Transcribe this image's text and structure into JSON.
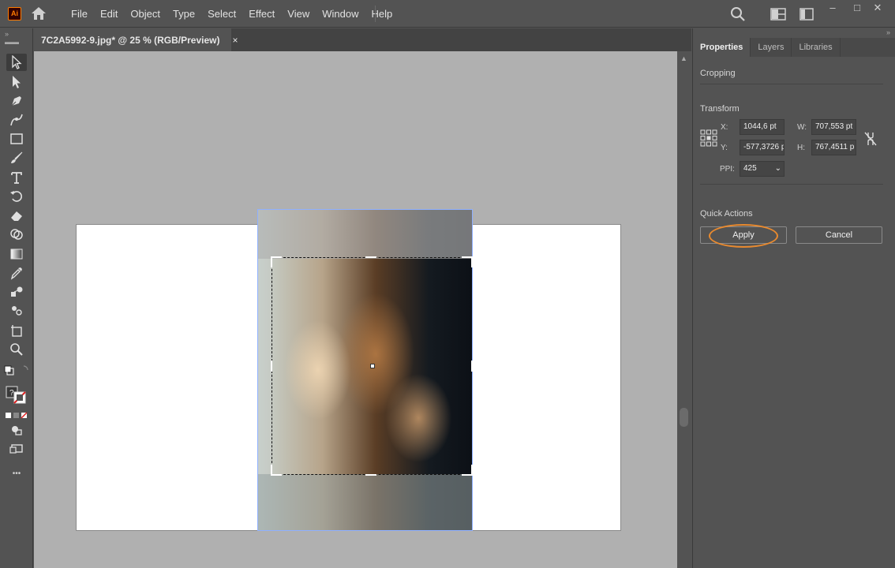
{
  "app": {
    "logo_text": "Ai"
  },
  "menu": {
    "items": [
      "File",
      "Edit",
      "Object",
      "Type",
      "Select",
      "Effect",
      "View",
      "Window",
      "Help"
    ]
  },
  "document": {
    "tab_title": "7C2A5992-9.jpg* @ 25 % (RGB/Preview)",
    "close_glyph": "×"
  },
  "toolbar": {
    "tools": [
      "selection-tool",
      "direct-selection-tool",
      "pen-tool",
      "curvature-tool",
      "rectangle-tool",
      "paintbrush-tool",
      "type-tool",
      "rotate-tool",
      "eraser-tool",
      "shape-builder-tool",
      "gradient-tool",
      "eyedropper-tool",
      "blend-tool",
      "symbol-sprayer-tool",
      "artboard-tool",
      "zoom-tool"
    ],
    "more_glyph": "•••"
  },
  "panel": {
    "tabs": [
      "Properties",
      "Layers",
      "Libraries"
    ],
    "active_tab": "Properties",
    "section_cropping": "Cropping",
    "section_transform": "Transform",
    "x_label": "X:",
    "x_value": "1044,6 pt",
    "y_label": "Y:",
    "y_value": "-577,3726 p",
    "w_label": "W:",
    "w_value": "707,553 pt",
    "h_label": "H:",
    "h_value": "767,4511 p",
    "ppi_label": "PPI:",
    "ppi_value": "425",
    "section_quick_actions": "Quick Actions",
    "apply_label": "Apply",
    "cancel_label": "Cancel"
  },
  "colors": {
    "ui_bg": "#535353",
    "canvas_bg": "#b0b0b0",
    "highlight_ring": "#e98a2f",
    "brand_orange": "#ff7c00"
  }
}
